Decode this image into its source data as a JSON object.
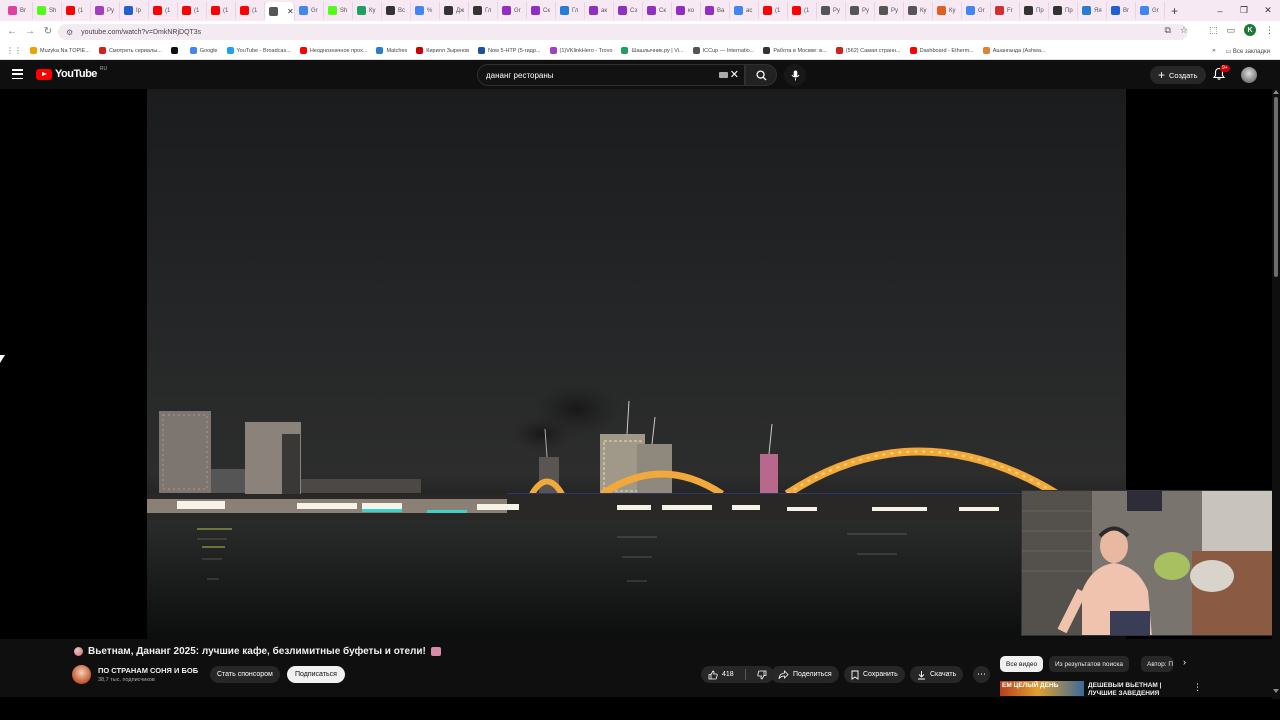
{
  "browser": {
    "tabs": [
      {
        "label": "Br",
        "icon": "heart-icon",
        "color": "#e040a0"
      },
      {
        "label": "Sh",
        "icon": "kick-icon",
        "color": "#53fc18"
      },
      {
        "label": "(1",
        "icon": "youtube-icon",
        "color": "#ff0000"
      },
      {
        "label": "Py",
        "icon": "feather-icon",
        "color": "#a040c0"
      },
      {
        "label": "Ip",
        "icon": "globe-icon",
        "color": "#2060d0"
      },
      {
        "label": "(1",
        "icon": "youtube-icon",
        "color": "#ff0000"
      },
      {
        "label": "(1",
        "icon": "youtube-icon",
        "color": "#ff0000"
      },
      {
        "label": "(1",
        "icon": "youtube-icon",
        "color": "#ff0000"
      },
      {
        "label": "(1",
        "icon": "youtube-icon",
        "color": "#ff0000"
      },
      {
        "label": "",
        "icon": "speaker-icon",
        "color": "#555555",
        "active": true
      },
      {
        "label": "Gr",
        "icon": "google-icon",
        "color": "#4285f4"
      },
      {
        "label": "Sh",
        "icon": "kick-icon",
        "color": "#53fc18"
      },
      {
        "label": "Ку",
        "icon": "leaf-icon",
        "color": "#20a060"
      },
      {
        "label": "Вс",
        "icon": "box-icon",
        "color": "#333333"
      },
      {
        "label": "%",
        "icon": "google-icon",
        "color": "#4285f4"
      },
      {
        "label": "Дж",
        "icon": "github-icon",
        "color": "#333333"
      },
      {
        "label": "Гл",
        "icon": "github-icon",
        "color": "#333333"
      },
      {
        "label": "Gr",
        "icon": "circle-icon",
        "color": "#9030c0"
      },
      {
        "label": "Ск",
        "icon": "circle-icon",
        "color": "#9030c0"
      },
      {
        "label": "Гл",
        "icon": "square-icon",
        "color": "#2a7bd3"
      },
      {
        "label": "ак",
        "icon": "circle-icon",
        "color": "#9030c0"
      },
      {
        "label": "Сз",
        "icon": "circle-icon",
        "color": "#9030c0"
      },
      {
        "label": "Ск",
        "icon": "circle-icon",
        "color": "#9030c0"
      },
      {
        "label": "ко",
        "icon": "circle-icon",
        "color": "#9030c0"
      },
      {
        "label": "Ва",
        "icon": "circle-icon",
        "color": "#9030c0"
      },
      {
        "label": "ас",
        "icon": "google-icon",
        "color": "#4285f4"
      },
      {
        "label": "(1",
        "icon": "youtube-icon",
        "color": "#ff0000"
      },
      {
        "label": "(1",
        "icon": "youtube-icon",
        "color": "#ff0000"
      },
      {
        "label": "Ру",
        "icon": "puzzle-icon",
        "color": "#555555"
      },
      {
        "label": "Ру",
        "icon": "puzzle-icon",
        "color": "#555555"
      },
      {
        "label": "Ру",
        "icon": "puzzle-icon",
        "color": "#555555"
      },
      {
        "label": "Ку",
        "icon": "puzzle-icon",
        "color": "#555555"
      },
      {
        "label": "Ку",
        "icon": "stack-icon",
        "color": "#e06020"
      },
      {
        "label": "Gr",
        "icon": "google-icon",
        "color": "#4285f4"
      },
      {
        "label": "Fr",
        "icon": "shield-icon",
        "color": "#d03030"
      },
      {
        "label": "Пр",
        "icon": "github-icon",
        "color": "#333333"
      },
      {
        "label": "Пр",
        "icon": "github-icon",
        "color": "#333333"
      },
      {
        "label": "Яя",
        "icon": "vk-icon",
        "color": "#2a7bd3"
      },
      {
        "label": "Br",
        "icon": "globe-icon",
        "color": "#2060d0"
      },
      {
        "label": "Gr",
        "icon": "google-icon",
        "color": "#4285f4"
      }
    ],
    "url": "youtube.com/watch?v=DmkNRjDQT3s",
    "bookmarks": [
      {
        "label": "Muzyka Na TOPIE...",
        "color": "#f0a000"
      },
      {
        "label": "Смотреть сериалы...",
        "color": "#d02020"
      },
      {
        "label": "",
        "color": "#111111"
      },
      {
        "label": "Google",
        "color": "#4285f4"
      },
      {
        "label": "YouTube - Broadcas...",
        "color": "#1da1f2"
      },
      {
        "label": "Неоднозначное прох...",
        "color": "#ff0000"
      },
      {
        "label": "Matches",
        "color": "#2a7bd3"
      },
      {
        "label": "Кирилл Зыренов",
        "color": "#cc0000"
      },
      {
        "label": "Now 5-HTP (5-гидр...",
        "color": "#1c4fa0"
      },
      {
        "label": "(1)VKlinkHero - Trovo",
        "color": "#a040c0"
      },
      {
        "label": "Шашлычник.ру | Vi...",
        "color": "#20a060"
      },
      {
        "label": "ICCup — Internatio...",
        "color": "#555555"
      },
      {
        "label": "Работа в Москве: в...",
        "color": "#333333"
      },
      {
        "label": "(562) Самая странн...",
        "color": "#d02020"
      },
      {
        "label": "Dashboard - Etherm...",
        "color": "#ff0000"
      },
      {
        "label": "Ашанганда (Ashwa...",
        "color": "#e08030"
      }
    ],
    "bookmarks_more": "»",
    "all_bookmarks": "Все закладки",
    "window_controls": [
      "–",
      "❐",
      "✕"
    ]
  },
  "youtube": {
    "logo_text": "YouTube",
    "region": "RU",
    "search_query": "дананг рестораны",
    "create_label": "Создать",
    "notification_badge": "9+",
    "video": {
      "title": "Вьетнам, Дананг 2025: лучшие кафе, безлимитные буфеты и отели!",
      "channel": "ПО СТРАНАМ СОНЯ И БОБ",
      "subscribers": "38,7 тыс. подписчиков",
      "sponsor_label": "Стать спонсором",
      "subscribe_label": "Подписаться",
      "likes": "418",
      "share_label": "Поделиться",
      "save_label": "Сохранить",
      "download_label": "Скачать"
    },
    "filter_chips": [
      "Все видео",
      "Из результатов поиска",
      "Автор: ПО СТРАНАМ СОНЯ И БОБ"
    ],
    "recommendation": {
      "thumb_text": "ЕМ ЦЕЛЫЙ ДЕНЬ",
      "title": "ДЕШЕВЫЙ ВЬЕТНАМ | ЛУЧШИЕ ЗАВЕДЕНИЯ"
    }
  },
  "colors": {
    "yt_background": "#0f0f0f",
    "yt_red": "#ff0000",
    "pill": "#272727",
    "bridge_lights": "#f2a93b",
    "browser_frame": "#f7e9f4"
  }
}
